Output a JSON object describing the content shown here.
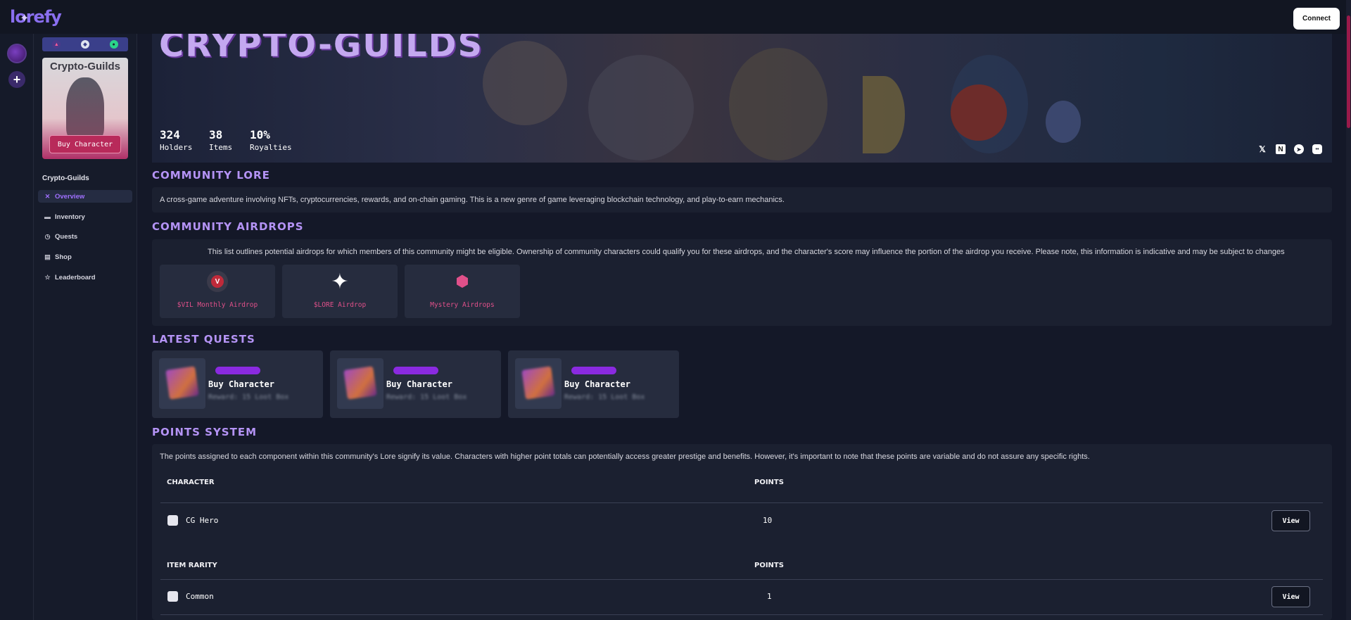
{
  "app": {
    "logo": "lorefy",
    "connect_label": "Connect"
  },
  "sidebar": {
    "card": {
      "title": "Crypto-Guilds",
      "buy_label": "Buy Character"
    },
    "section_title": "Crypto-Guilds",
    "items": [
      {
        "label": "Overview",
        "icon": "compass-icon",
        "active": true
      },
      {
        "label": "Inventory",
        "icon": "briefcase-icon",
        "active": false
      },
      {
        "label": "Quests",
        "icon": "clock-icon",
        "active": false
      },
      {
        "label": "Shop",
        "icon": "store-icon",
        "active": false
      },
      {
        "label": "Leaderboard",
        "icon": "star-icon",
        "active": false
      }
    ]
  },
  "hero": {
    "title": "CRYPTO-GUILDS",
    "stats": [
      {
        "value": "324",
        "label": "Holders"
      },
      {
        "value": "38",
        "label": "Items"
      },
      {
        "value": "10%",
        "label": "Royalties"
      }
    ],
    "socials": [
      "x-icon",
      "notion-icon",
      "telegram-icon",
      "discord-icon"
    ]
  },
  "lore": {
    "heading": "COMMUNITY LORE",
    "text": "A cross-game adventure involving NFTs, cryptocurrencies, rewards, and on-chain gaming. This is a new genre of game leveraging blockchain technology, and play-to-earn mechanics."
  },
  "airdrops": {
    "heading": "COMMUNITY AIRDROPS",
    "text": "This list outlines potential airdrops for which members of this community might be eligible. Ownership of community characters could qualify you for these airdrops, and the character's score may influence the portion of the airdrop you receive. Please note, this information is indicative and may be subject to changes",
    "items": [
      {
        "label": "$VIL Monthly Airdrop",
        "icon": "vil-token-icon"
      },
      {
        "label": "$LORE Airdrop",
        "icon": "sparkle-icon"
      },
      {
        "label": "Mystery Airdrops",
        "icon": "cube-icon"
      }
    ]
  },
  "quests": {
    "heading": "LATEST QUESTS",
    "items": [
      {
        "title": "Buy Character",
        "reward": "Reward: 15 Loot Box"
      },
      {
        "title": "Buy Character",
        "reward": "Reward: 15 Loot Box"
      },
      {
        "title": "Buy Character",
        "reward": "Reward: 15 Loot Box"
      }
    ]
  },
  "points": {
    "heading": "POINTS SYSTEM",
    "text": "The points assigned to each component within this community's Lore signify its value. Characters with higher point totals can potentially access greater prestige and benefits. However, it's important to note that these points are variable and do not assure any specific rights.",
    "tables": [
      {
        "col1": "CHARACTER",
        "col2": "POINTS",
        "rows": [
          {
            "name": "CG Hero",
            "points": "10",
            "action": "View"
          }
        ]
      },
      {
        "col1": "ITEM RARITY",
        "col2": "POINTS",
        "rows": [
          {
            "name": "Common",
            "points": "1",
            "action": "View"
          }
        ]
      }
    ]
  },
  "colors": {
    "accent": "#b493f5",
    "pink": "#e0508a",
    "quest_pill": "#8a2ae0",
    "background": "#141828"
  }
}
